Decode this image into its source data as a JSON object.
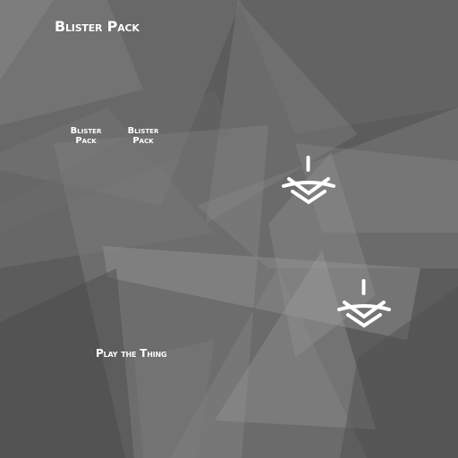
{
  "screen": {
    "title": "Blister Pack",
    "background_color": "#5f5f5f"
  },
  "packs": [
    {
      "line1": "Blister",
      "line2": "Pack"
    },
    {
      "line1": "Blister",
      "line2": "Pack"
    }
  ],
  "play_label": "Play the Thing",
  "markers": [
    {
      "icon": "landing-marker-icon",
      "color": "#ffffff"
    },
    {
      "icon": "landing-marker-icon",
      "color": "#ffffff"
    }
  ]
}
